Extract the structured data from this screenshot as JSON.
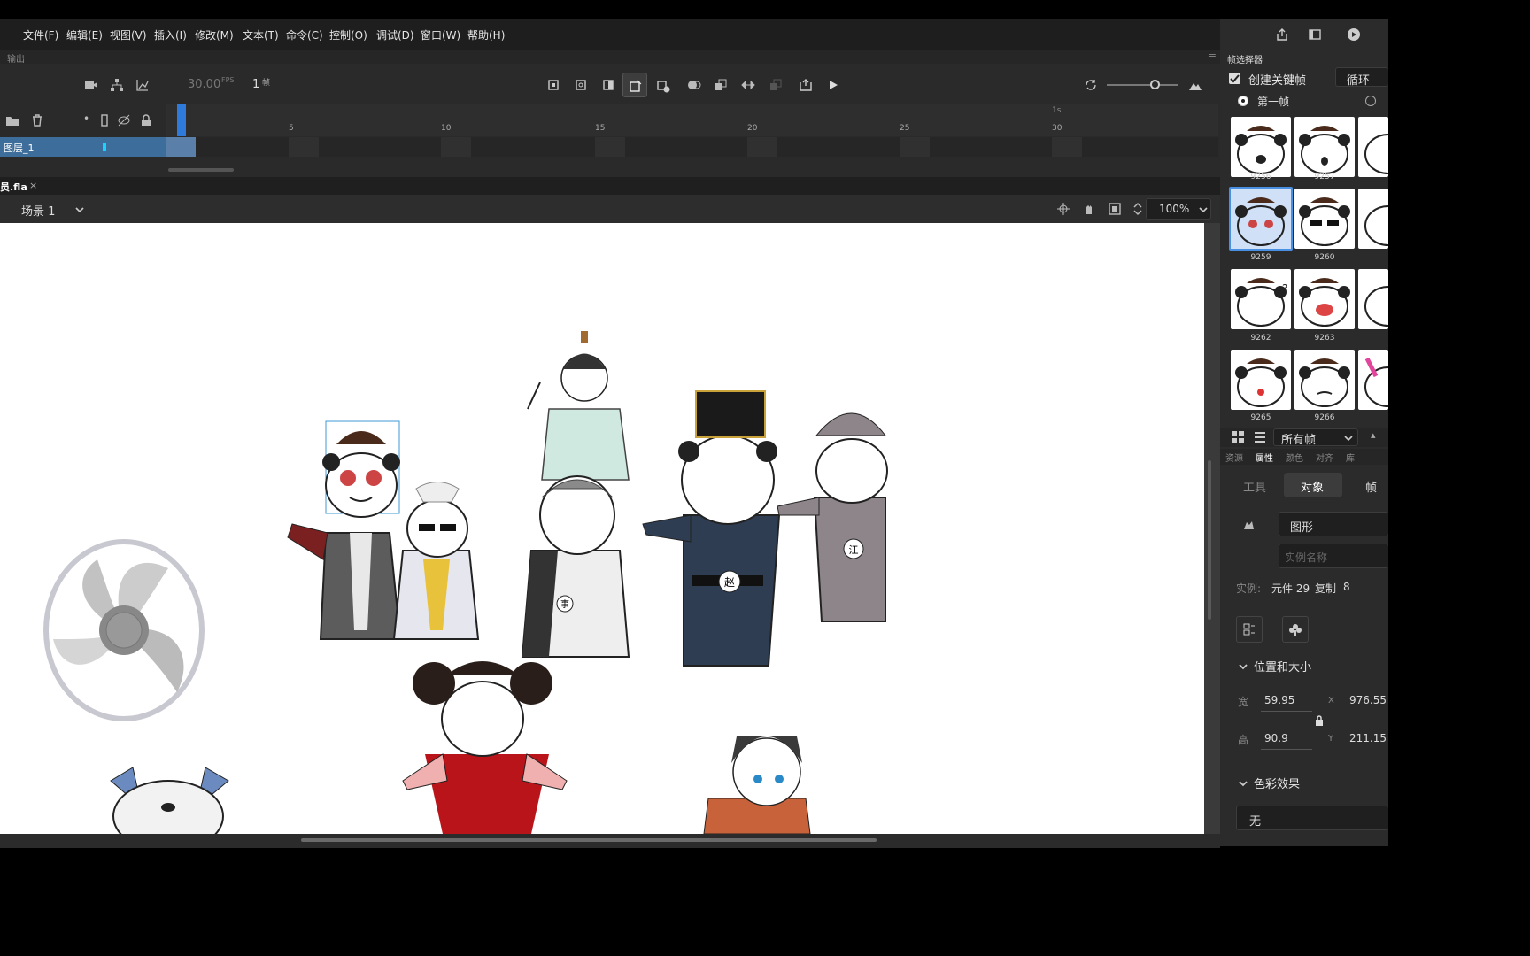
{
  "menu": {
    "items": [
      "文件(F)",
      "编辑(E)",
      "视图(V)",
      "插入(I)",
      "修改(M)",
      "文本(T)",
      "命令(C)",
      "控制(O)",
      "调试(D)",
      "窗口(W)",
      "帮助(H)"
    ]
  },
  "timeline": {
    "panel_label": "输出",
    "fps": "30.00",
    "fps_unit": "FPS",
    "frame": "1",
    "frame_unit": "帧",
    "ruler_ticks": [
      "5",
      "10",
      "15",
      "20",
      "25",
      "30"
    ],
    "ruler_marker": "1s",
    "layer_name": "图层_1"
  },
  "document": {
    "tab_name": "员.fla",
    "scene_label": "场景 1",
    "zoom": "100%"
  },
  "frame_picker": {
    "title": "帧选择器",
    "create_keyframe": "创建关键帧",
    "loop_label": "循环",
    "first_frame": "第一帧",
    "thumbnails": [
      "9256",
      "9257",
      "9259",
      "9260",
      "9262",
      "9263",
      "9265",
      "9266"
    ],
    "filter": "所有帧"
  },
  "properties": {
    "tabs": [
      "资源",
      "属性",
      "颜色",
      "对齐",
      "库"
    ],
    "subtabs": [
      "工具",
      "对象",
      "帧"
    ],
    "type": "图形",
    "instance_placeholder": "实例名称",
    "instance_label": "实例:",
    "instance_value": "元件 29",
    "copy_label": "复制",
    "copy_value": "8",
    "position_section": "位置和大小",
    "width_label": "宽",
    "width": "59.95",
    "height_label": "高",
    "height": "90.9",
    "x_label": "X",
    "x": "976.55",
    "y_label": "Y",
    "y": "211.15",
    "color_section": "色彩效果",
    "color_effect": "无"
  },
  "stage_labels": {
    "badge_zhao": "赵",
    "badge_jiang": "江",
    "badge_shi": "事"
  }
}
